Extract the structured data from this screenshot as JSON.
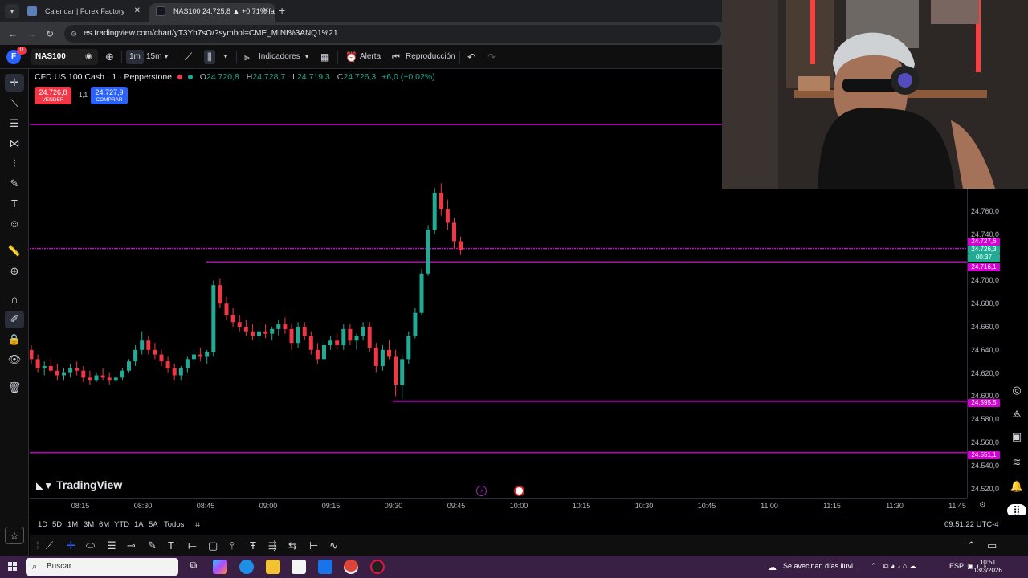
{
  "browser": {
    "tabs": [
      {
        "title": "Calendar | Forex Factory",
        "active": false,
        "icon": "forexfactory-icon",
        "color": "#5b7fb8"
      },
      {
        "title": "NAS100 24.725,8 ▲ +0.71% fat",
        "active": true,
        "icon": "tradingview-icon",
        "color": "#131722"
      }
    ],
    "url": "es.tradingview.com/chart/yT3Yh7sO/?symbol=CME_MINI%3ANQ1%21"
  },
  "toolbar": {
    "avatar_letter": "F",
    "notification_count": "11",
    "symbol": "NAS100",
    "interval_1m": "1m",
    "interval_15m": "15m",
    "indicators": "Indicadores",
    "alert": "Alerta",
    "replay": "Reproducción"
  },
  "legend": {
    "symbol": "CFD US 100 Cash · 1 · Pepperstone",
    "open_label": "O",
    "open": "24.720,8",
    "high_label": "H",
    "high": "24.728,7",
    "low_label": "L",
    "low": "24.719,3",
    "close_label": "C",
    "close": "24.726,3",
    "change": "+6,0 (+0,02%)"
  },
  "trade": {
    "sell_price": "24.726,8",
    "sell_label": "VENDER",
    "spread": "1,1",
    "buy_price": "24.727,9",
    "buy_label": "COMPRAR"
  },
  "watermark": "TradingView",
  "price_axis": {
    "labels": [
      "24.760,0",
      "24.740,0",
      "24.700,0",
      "24.680,0",
      "24.660,0",
      "24.640,0",
      "24.620,0",
      "24.600,0",
      "24.580,0",
      "24.560,0",
      "24.540,0",
      "24.520,0"
    ],
    "tags": [
      {
        "text": "24.727,6",
        "color": "#d500d5"
      },
      {
        "text": "24.726,3",
        "color": "#22ab94"
      },
      {
        "text": "00:37",
        "color": "#22ab94"
      },
      {
        "text": "24.716,1",
        "color": "#d500d5"
      },
      {
        "text": "24.595,5",
        "color": "#d500d5"
      },
      {
        "text": "24.551,1",
        "color": "#d500d5"
      }
    ]
  },
  "time_axis": [
    "08:15",
    "08:30",
    "08:45",
    "09:00",
    "09:15",
    "09:30",
    "09:45",
    "10:00",
    "10:15",
    "10:30",
    "10:45",
    "11:00",
    "11:15",
    "11:30",
    "11:45"
  ],
  "ranges": [
    "1D",
    "5D",
    "1M",
    "3M",
    "6M",
    "YTD",
    "1A",
    "5A",
    "Todos"
  ],
  "clock": "09:51:22 UTC-4",
  "colors": {
    "up": "#22ab94",
    "down": "#f23645",
    "level": "#d500d5"
  },
  "chart_data": {
    "type": "candlestick",
    "levels": [
      24727.6,
      24716.1,
      24595.5,
      24551.1
    ],
    "candles_ohlc": [
      [
        24640,
        24644,
        24628,
        24632
      ],
      [
        24632,
        24636,
        24620,
        24624
      ],
      [
        24624,
        24630,
        24618,
        24626
      ],
      [
        24626,
        24632,
        24620,
        24622
      ],
      [
        24622,
        24628,
        24614,
        24618
      ],
      [
        24618,
        24624,
        24614,
        24620
      ],
      [
        24620,
        24628,
        24616,
        24624
      ],
      [
        24624,
        24630,
        24618,
        24622
      ],
      [
        24622,
        24626,
        24612,
        24616
      ],
      [
        24616,
        24622,
        24610,
        24614
      ],
      [
        24614,
        24620,
        24612,
        24618
      ],
      [
        24618,
        24624,
        24614,
        24616
      ],
      [
        24616,
        24620,
        24610,
        24614
      ],
      [
        24614,
        24618,
        24612,
        24616
      ],
      [
        24616,
        24624,
        24614,
        24622
      ],
      [
        24622,
        24632,
        24620,
        24630
      ],
      [
        24630,
        24644,
        24626,
        24640
      ],
      [
        24640,
        24656,
        24636,
        24648
      ],
      [
        24648,
        24652,
        24636,
        24640
      ],
      [
        24640,
        24646,
        24632,
        24636
      ],
      [
        24636,
        24640,
        24626,
        24630
      ],
      [
        24630,
        24634,
        24620,
        24624
      ],
      [
        24624,
        24628,
        24614,
        24618
      ],
      [
        24618,
        24626,
        24614,
        24624
      ],
      [
        24624,
        24634,
        24620,
        24632
      ],
      [
        24632,
        24640,
        24628,
        24636
      ],
      [
        24636,
        24642,
        24630,
        24634
      ],
      [
        24634,
        24640,
        24628,
        24638
      ],
      [
        24638,
        24700,
        24634,
        24696
      ],
      [
        24696,
        24702,
        24676,
        24680
      ],
      [
        24680,
        24686,
        24666,
        24670
      ],
      [
        24670,
        24676,
        24660,
        24664
      ],
      [
        24664,
        24670,
        24656,
        24660
      ],
      [
        24660,
        24666,
        24652,
        24656
      ],
      [
        24656,
        24662,
        24648,
        24652
      ],
      [
        24652,
        24660,
        24646,
        24656
      ],
      [
        24656,
        24662,
        24650,
        24654
      ],
      [
        24654,
        24660,
        24648,
        24658
      ],
      [
        24658,
        24666,
        24652,
        24662
      ],
      [
        24662,
        24668,
        24654,
        24658
      ],
      [
        24658,
        24662,
        24640,
        24646
      ],
      [
        24646,
        24664,
        24642,
        24660
      ],
      [
        24660,
        24664,
        24648,
        24652
      ],
      [
        24652,
        24656,
        24636,
        24640
      ],
      [
        24640,
        24646,
        24628,
        24632
      ],
      [
        24632,
        24648,
        24630,
        24644
      ],
      [
        24644,
        24652,
        24640,
        24648
      ],
      [
        24648,
        24654,
        24640,
        24644
      ],
      [
        24644,
        24662,
        24640,
        24658
      ],
      [
        24658,
        24662,
        24644,
        24648
      ],
      [
        24648,
        24654,
        24640,
        24652
      ],
      [
        24652,
        24664,
        24648,
        24660
      ],
      [
        24660,
        24664,
        24638,
        24642
      ],
      [
        24642,
        24646,
        24620,
        24626
      ],
      [
        24626,
        24644,
        24622,
        24640
      ],
      [
        24640,
        24648,
        24632,
        24634
      ],
      [
        24634,
        24640,
        24600,
        24610
      ],
      [
        24610,
        24636,
        24598,
        24632
      ],
      [
        24632,
        24656,
        24628,
        24652
      ],
      [
        24652,
        24676,
        24650,
        24672
      ],
      [
        24672,
        24710,
        24670,
        24706
      ],
      [
        24706,
        24748,
        24704,
        24744
      ],
      [
        24744,
        24780,
        24740,
        24776
      ],
      [
        24776,
        24784,
        24756,
        24762
      ],
      [
        24762,
        24770,
        24744,
        24750
      ],
      [
        24750,
        24754,
        24728,
        24734
      ],
      [
        24734,
        24738,
        24722,
        24726
      ]
    ]
  }
}
